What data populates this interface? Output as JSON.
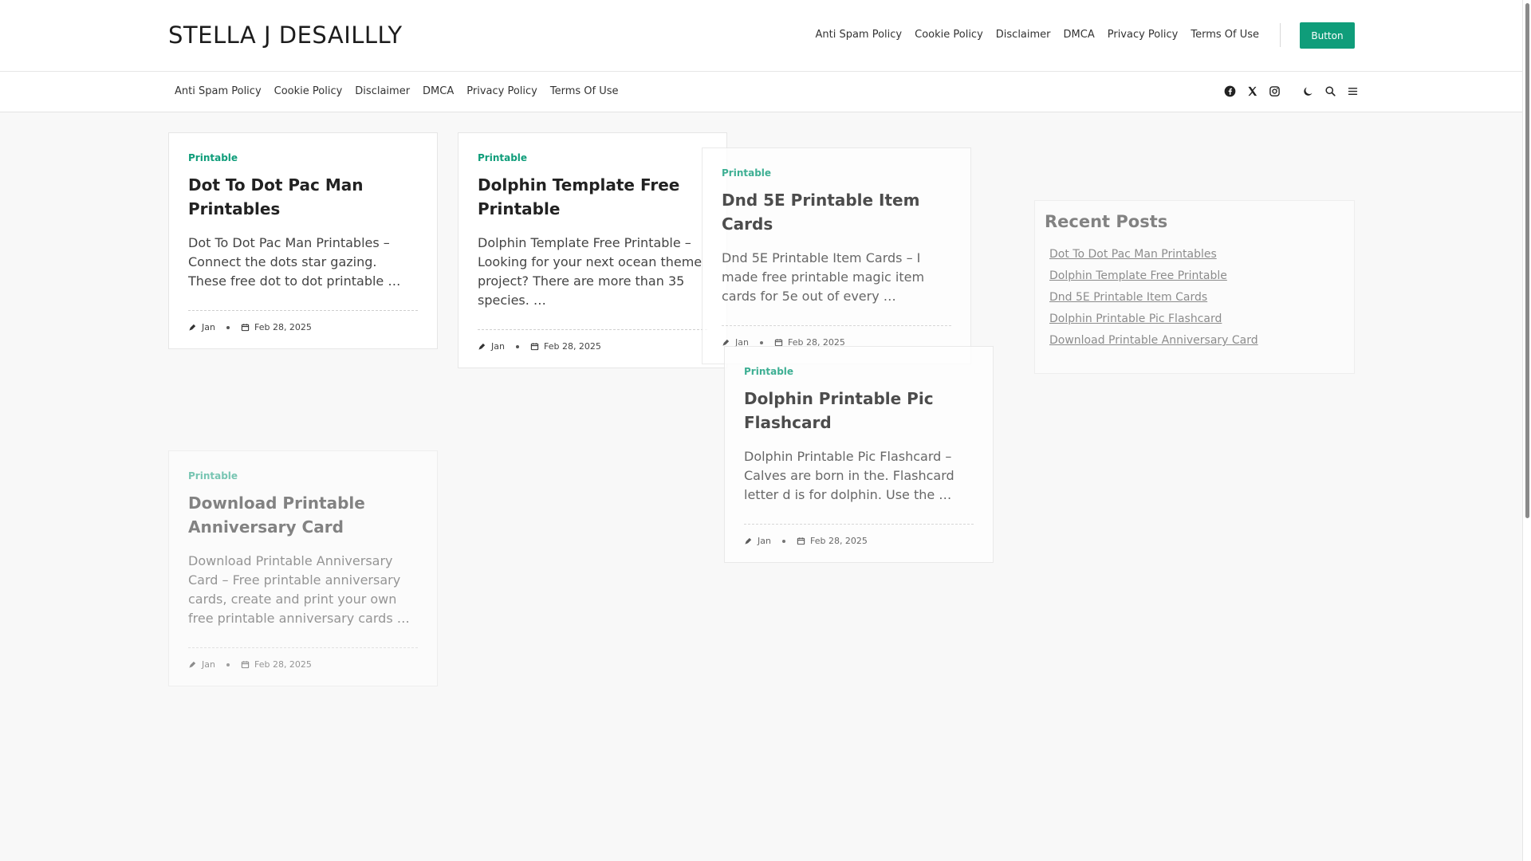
{
  "site": {
    "title": "STELLA J DESAILLLY"
  },
  "top_nav": [
    "Anti Spam Policy",
    "Cookie Policy",
    "Disclaimer",
    "DMCA",
    "Privacy Policy",
    "Terms Of Use"
  ],
  "header_button": "Button",
  "sub_nav": [
    "Anti Spam Policy",
    "Cookie Policy",
    "Disclaimer",
    "DMCA",
    "Privacy Policy",
    "Terms Of Use"
  ],
  "icons": [
    "facebook-icon",
    "x-icon",
    "instagram-icon",
    "moon-icon",
    "search-icon",
    "menu-icon"
  ],
  "accent_color": "#0f9d7a",
  "posts": [
    {
      "category": "Printable",
      "title": "Dot To Dot Pac Man Printables",
      "excerpt": "Dot To Dot Pac Man Printables – Connect the dots star gazing. These free dot to dot printable …",
      "author": "Jan",
      "date": "Feb 28, 2025"
    },
    {
      "category": "Printable",
      "title": "Dolphin Template Free Printable",
      "excerpt": "Dolphin Template Free Printable – Looking for your next ocean theme project? There are more than 35 species. …",
      "author": "Jan",
      "date": "Feb 28, 2025"
    },
    {
      "category": "Printable",
      "title": "Dnd 5E Printable Item Cards",
      "excerpt": "Dnd 5E Printable Item Cards – I made free printable magic item cards for 5e out of every …",
      "author": "Jan",
      "date": "Feb 28, 2025"
    },
    {
      "category": "Printable",
      "title": "Dolphin Printable Pic Flashcard",
      "excerpt": "Dolphin Printable Pic Flashcard – Calves are born in the. Flashcard letter d is for dolphin. Use the …",
      "author": "Jan",
      "date": "Feb 28, 2025"
    },
    {
      "category": "Printable",
      "title": "Download Printable Anniversary Card",
      "excerpt": "Download Printable Anniversary Card – Free printable anniversary cards, create and print your own free printable anniversary cards …",
      "author": "Jan",
      "date": "Feb 28, 2025"
    }
  ],
  "sidebar": {
    "title": "Recent Posts",
    "items": [
      "Dot To Dot Pac Man Printables",
      "Dolphin Template Free Printable",
      "Dnd 5E Printable Item Cards",
      "Dolphin Printable Pic Flashcard",
      "Download Printable Anniversary Card"
    ]
  }
}
